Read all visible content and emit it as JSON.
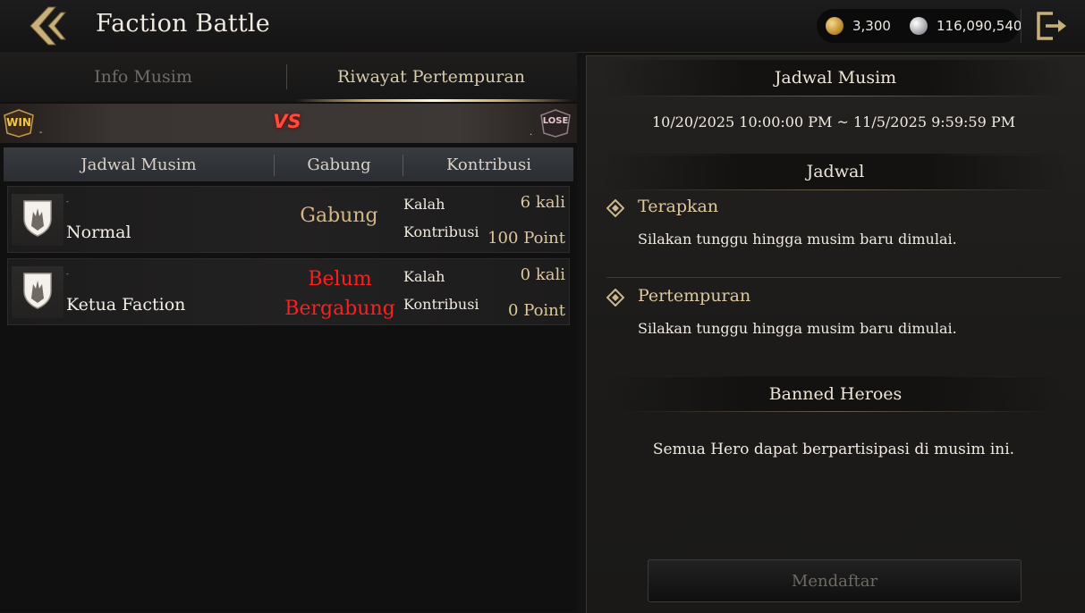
{
  "header": {
    "title": "Faction Battle",
    "currency": [
      {
        "icon": "gold-coin-icon",
        "value": "3,300"
      },
      {
        "icon": "silver-coin-icon",
        "value": "116,090,540"
      }
    ]
  },
  "tabs": [
    {
      "label": "Info Musim",
      "active": false
    },
    {
      "label": "Riwayat Pertempuran",
      "active": true
    }
  ],
  "battle_bar": {
    "win_badge": "WIN",
    "vs": "VS",
    "lose_badge": "LOSE"
  },
  "table": {
    "columns": [
      "Jadwal Musim",
      "Gabung",
      "Kontribusi"
    ],
    "rows": [
      {
        "name": "Normal",
        "status": "Gabung",
        "status_line2": "",
        "label_1": "Kalah",
        "value_1": "6 kali",
        "label_2": "Kontribusi",
        "value_2": "100 Point"
      },
      {
        "name": "Ketua Faction",
        "status": "Belum",
        "status_line2": "Bergabung",
        "label_1": "Kalah",
        "value_1": "0 kali",
        "label_2": "Kontribusi",
        "value_2": "0 Point"
      }
    ]
  },
  "right": {
    "schedule_title": "Jadwal Musim",
    "season_range": "10/20/2025 10:00:00 PM ~ 11/5/2025 9:59:59 PM",
    "jadwal_title": "Jadwal",
    "entries": [
      {
        "title": "Terapkan",
        "text": "Silakan tunggu hingga musim baru dimulai."
      },
      {
        "title": "Pertempuran",
        "text": "Silakan tunggu hingga musim baru dimulai."
      }
    ],
    "banned_title": "Banned Heroes",
    "banned_text": "Semua Hero dapat berpartisipasi di musim ini.",
    "register_label": "Mendaftar"
  },
  "colors": {
    "accent_gold": "#dcc79e",
    "not_joined_red": "#ff1e1e",
    "vs_red": "#ff4b3a"
  }
}
